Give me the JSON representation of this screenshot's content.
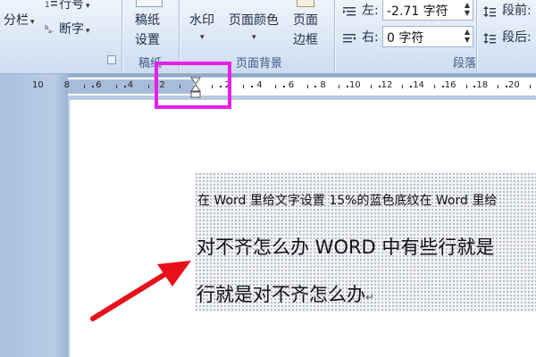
{
  "ribbon": {
    "columns_label": "分栏",
    "line_numbers_label": "行号",
    "hyphenation_label": "断字",
    "manuscript_line1": "稿纸",
    "manuscript_line2": "设置",
    "manuscript_group": "稿纸",
    "watermark_label": "水印",
    "page_color_label": "页面颜色",
    "page_border_line1": "页面",
    "page_border_line2": "边框",
    "page_background_group": "页面背景",
    "indent_left_label": "左:",
    "indent_left_value": "-2.71 字符",
    "indent_right_label": "右:",
    "indent_right_value": "0 字符",
    "spacing_before_label": "段前:",
    "spacing_after_label": "段后:",
    "paragraph_group": "段落"
  },
  "ruler": {
    "left_numbers": [
      "10",
      "8",
      "6",
      "4",
      "2"
    ],
    "right_numbers": [
      "2",
      "4",
      "6",
      "8",
      "10",
      "12",
      "14",
      "16",
      "18",
      "20"
    ]
  },
  "document": {
    "line1": "在 Word 里给文字设置 15%的蓝色底纹在 Word 里给",
    "line2": "对不齐怎么办 WORD 中有些行就是",
    "line3": "行就是对不齐怎么办",
    "paragraph_mark": "↵"
  },
  "colors": {
    "highlight": "#e81fe8",
    "arrow": "#e8101a"
  }
}
